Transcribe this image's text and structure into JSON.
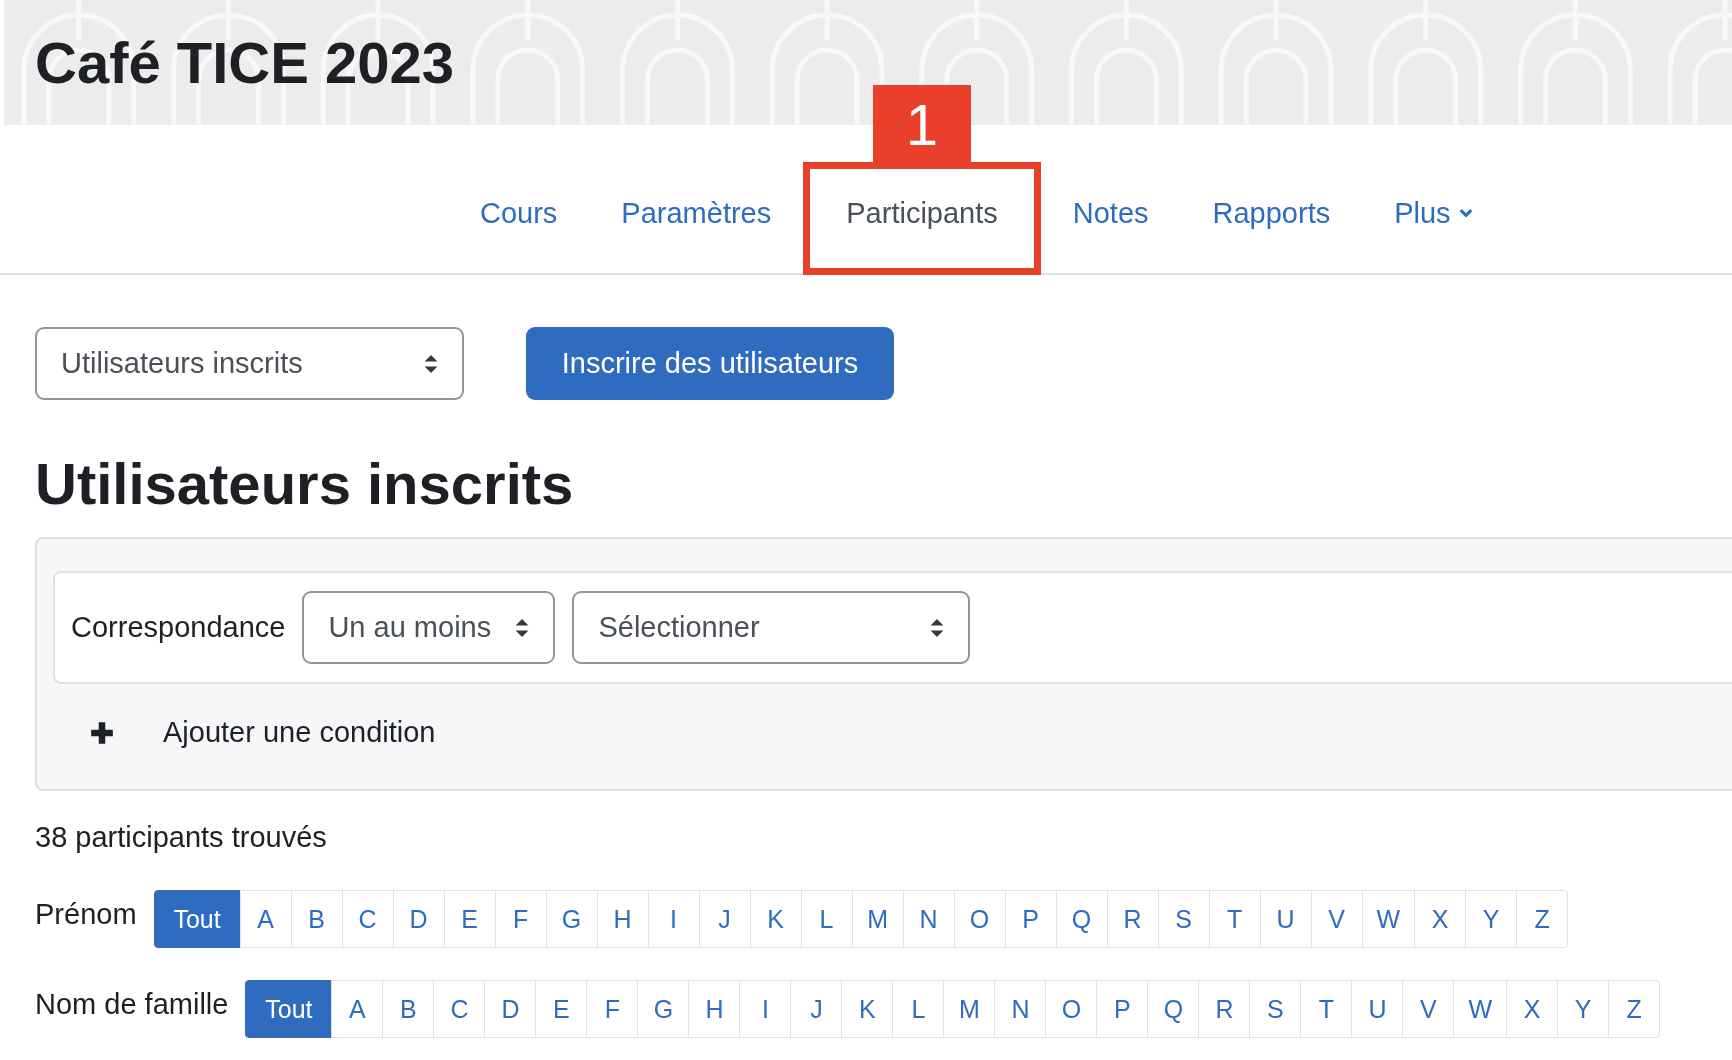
{
  "course": {
    "title": "Café TICE 2023"
  },
  "nav": [
    {
      "label": "Cours",
      "selected": false,
      "kind": "link"
    },
    {
      "label": "Paramètres",
      "selected": false,
      "kind": "link"
    },
    {
      "label": "Participants",
      "selected": true,
      "kind": "link",
      "highlighted": true
    },
    {
      "label": "Notes",
      "selected": false,
      "kind": "link"
    },
    {
      "label": "Rapports",
      "selected": false,
      "kind": "link"
    },
    {
      "label": "Plus",
      "selected": false,
      "kind": "menu"
    }
  ],
  "annotation": {
    "label": "1"
  },
  "page_select": {
    "value": "Utilisateurs inscrits"
  },
  "enrol_button": "Inscrire des utilisateurs",
  "heading": "Utilisateurs inscrits",
  "filter": {
    "match_label": "Correspondance",
    "match_select": "Un au moins",
    "type_select": "Sélectionner",
    "add_condition": "Ajouter une condition"
  },
  "count": "38 participants trouvés",
  "initials_bars": [
    {
      "label": "Prénom",
      "items": [
        {
          "label": "Tout",
          "selected": true
        },
        {
          "label": "A",
          "selected": false
        },
        {
          "label": "B",
          "selected": false
        },
        {
          "label": "C",
          "selected": false
        },
        {
          "label": "D",
          "selected": false
        },
        {
          "label": "E",
          "selected": false
        },
        {
          "label": "F",
          "selected": false
        },
        {
          "label": "G",
          "selected": false
        },
        {
          "label": "H",
          "selected": false
        },
        {
          "label": "I",
          "selected": false
        },
        {
          "label": "J",
          "selected": false
        },
        {
          "label": "K",
          "selected": false
        },
        {
          "label": "L",
          "selected": false
        },
        {
          "label": "M",
          "selected": false
        },
        {
          "label": "N",
          "selected": false
        },
        {
          "label": "O",
          "selected": false
        },
        {
          "label": "P",
          "selected": false
        },
        {
          "label": "Q",
          "selected": false
        },
        {
          "label": "R",
          "selected": false
        },
        {
          "label": "S",
          "selected": false
        },
        {
          "label": "T",
          "selected": false
        },
        {
          "label": "U",
          "selected": false
        },
        {
          "label": "V",
          "selected": false
        },
        {
          "label": "W",
          "selected": false
        },
        {
          "label": "X",
          "selected": false
        },
        {
          "label": "Y",
          "selected": false
        },
        {
          "label": "Z",
          "selected": false
        }
      ]
    },
    {
      "label": "Nom de famille",
      "items": [
        {
          "label": "Tout",
          "selected": true
        },
        {
          "label": "A",
          "selected": false
        },
        {
          "label": "B",
          "selected": false
        },
        {
          "label": "C",
          "selected": false
        },
        {
          "label": "D",
          "selected": false
        },
        {
          "label": "E",
          "selected": false
        },
        {
          "label": "F",
          "selected": false
        },
        {
          "label": "G",
          "selected": false
        },
        {
          "label": "H",
          "selected": false
        },
        {
          "label": "I",
          "selected": false
        },
        {
          "label": "J",
          "selected": false
        },
        {
          "label": "K",
          "selected": false
        },
        {
          "label": "L",
          "selected": false
        },
        {
          "label": "M",
          "selected": false
        },
        {
          "label": "N",
          "selected": false
        },
        {
          "label": "O",
          "selected": false
        },
        {
          "label": "P",
          "selected": false
        },
        {
          "label": "Q",
          "selected": false
        },
        {
          "label": "R",
          "selected": false
        },
        {
          "label": "S",
          "selected": false
        },
        {
          "label": "T",
          "selected": false
        },
        {
          "label": "U",
          "selected": false
        },
        {
          "label": "V",
          "selected": false
        },
        {
          "label": "W",
          "selected": false
        },
        {
          "label": "X",
          "selected": false
        },
        {
          "label": "Y",
          "selected": false
        },
        {
          "label": "Z",
          "selected": false
        }
      ]
    }
  ]
}
